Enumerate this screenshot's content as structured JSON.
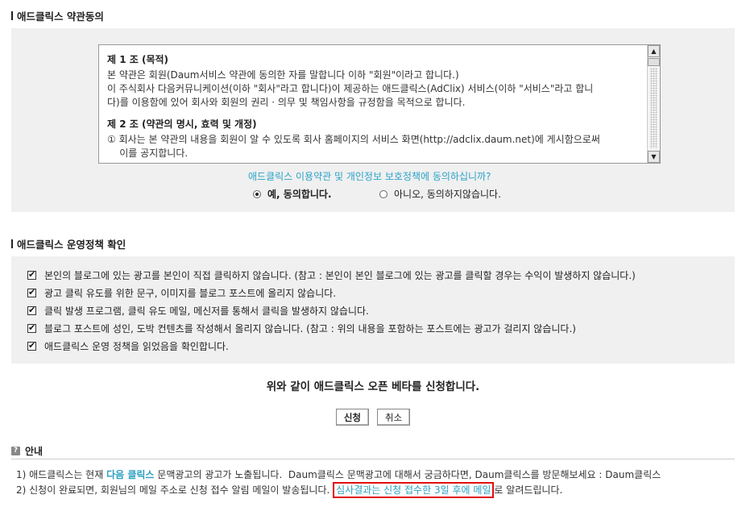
{
  "terms": {
    "title": "애드클릭스 약관동의",
    "articles": [
      {
        "title": "제 1 조 (목적)",
        "body": [
          "본 약관은 회원(Daum서비스 약관에 동의한 자를 말합니다 이하 \"회원\"이라고 합니다.)",
          "이 주식회사 다음커뮤니케이션(이하 \"회사\"라고 합니다)이 제공하는 애드클릭스(AdClix) 서비스(이하 \"서비스\"라고 합니",
          "다)를 이용함에 있어 회사와 회원의 권리 · 의무 및 책임사항을 규정함을 목적으로 합니다."
        ]
      },
      {
        "title": "제 2 조 (약관의 명시, 효력 및 개정)",
        "body": [
          "① 회사는 본 약관의 내용을 회원이 알 수 있도록 회사 홈페이지의 서비스 화면(http://adclix.daum.net)에 게시함으로써",
          "    이를 공지합니다."
        ]
      }
    ],
    "question": "애드클릭스 이용약관 및 개인정보 보호정책에 동의하십니까?",
    "agree_label": "예, 동의합니다.",
    "disagree_label": "아니오, 동의하지않습니다."
  },
  "policy": {
    "title": "애드클릭스 운영정책 확인",
    "items": [
      "본인의 블로그에 있는 광고를 본인이 직접 클릭하지 않습니다. (참고 : 본인이 본인 블로그에 있는 광고를 클릭할 경우는 수익이 발생하지 않습니다.)",
      "광고 클릭 유도를 위한 문구, 이미지를 블로그 포스트에 올리지 않습니다.",
      "클릭 발생 프로그램, 클릭 유도 메일, 메신저를 통해서 클릭을 발생하지 않습니다.",
      "블로그 포스트에 성인, 도박 컨텐츠를 작성해서 올리지 않습니다. (참고 : 위의 내용을 포함하는 포스트에는 광고가 걸리지 않습니다.)",
      "애드클릭스 운영 정책을 읽었음을 확인합니다."
    ]
  },
  "apply": {
    "text": "위와 같이 애드클릭스 오픈 베타를 신청합니다.",
    "submit_label": "신청",
    "cancel_label": "취소"
  },
  "info": {
    "icon_glyph": "?",
    "title": "안내",
    "line1_prefix": "1) 애드클릭스는 현재 ",
    "line1_highlight": "다음 클릭스",
    "line1_suffix": " 문맥광고의 광고가 노출됩니다.  Daum클릭스 문맥광고에 대해서 궁금하다면, Daum클릭스를 방문해보세요 : Daum클릭스",
    "line2_prefix": "2) 신청이 완료되면, 회원님의 메일 주소로 신청 접수 알림 메일이 발송됩니다. ",
    "line2_highlight": "심사결과는 신청 접수한 3일 후에 메일",
    "line2_suffix": "로 알려드립니다."
  }
}
